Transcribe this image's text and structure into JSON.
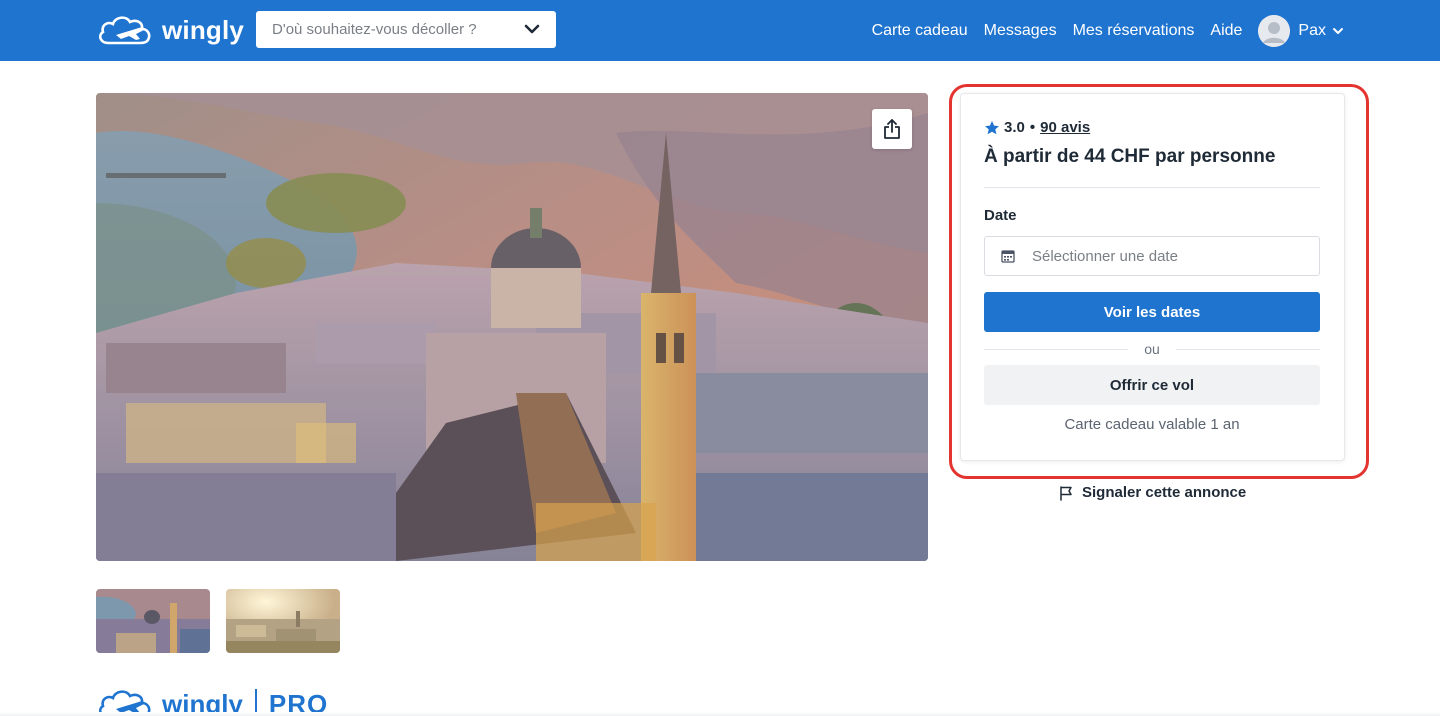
{
  "header": {
    "brand": "wingly",
    "search_placeholder": "D'où souhaitez-vous décoller ?",
    "nav": {
      "gift_card": "Carte cadeau",
      "messages": "Messages",
      "reservations": "Mes réservations",
      "help": "Aide"
    },
    "user_name": "Pax",
    "background_color": "#1f74d0"
  },
  "booking": {
    "rating": "3.0",
    "separator": "•",
    "reviews_link": "90 avis",
    "price_text": "À partir de 44 CHF par personne",
    "date_label": "Date",
    "date_placeholder": "Sélectionner une date",
    "see_dates_button": "Voir les dates",
    "or_text": "ou",
    "gift_button": "Offrir ce vol",
    "gift_note": "Carte cadeau valable 1 an",
    "accent_color": "#1f74d0",
    "highlight_color": "#e3342f"
  },
  "report_link": "Signaler cette annonce",
  "footer": {
    "brand": "wingly",
    "pro_label": "PRO"
  },
  "icons": {
    "logo": "wingly-plane-cloud-icon",
    "search_chevron": "chevron-down-icon",
    "avatar": "user-avatar-icon",
    "user_caret": "chevron-down-icon",
    "share": "share-icon",
    "star": "star-icon",
    "calendar": "calendar-icon",
    "flag": "flag-icon"
  }
}
